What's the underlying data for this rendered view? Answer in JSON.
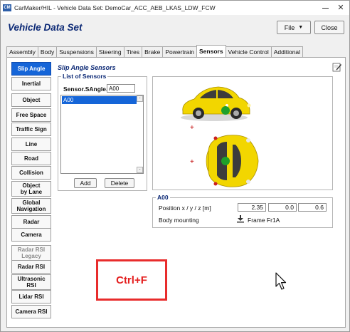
{
  "window": {
    "app_icon_text": "CM",
    "title": "CarMaker/HIL - Vehicle Data Set: DemoCar_ACC_AEB_LKAS_LDW_FCW"
  },
  "header": {
    "title": "Vehicle Data Set",
    "file_label": "File",
    "close_label": "Close"
  },
  "tabs": [
    {
      "label": "Assembly"
    },
    {
      "label": "Body"
    },
    {
      "label": "Suspensions"
    },
    {
      "label": "Steering"
    },
    {
      "label": "Tires"
    },
    {
      "label": "Brake"
    },
    {
      "label": "Powertrain"
    },
    {
      "label": "Sensors"
    },
    {
      "label": "Vehicle Control"
    },
    {
      "label": "Additional"
    }
  ],
  "sidebar": [
    {
      "label": "Slip Angle"
    },
    {
      "label": "Inertial"
    },
    {
      "label": "Object"
    },
    {
      "label": "Free Space"
    },
    {
      "label": "Traffic Sign"
    },
    {
      "label": "Line"
    },
    {
      "label": "Road"
    },
    {
      "label": "Collision"
    },
    {
      "label": "Object\nby Lane"
    },
    {
      "label": "Global\nNavigation"
    },
    {
      "label": "Radar"
    },
    {
      "label": "Camera"
    },
    {
      "label": "Radar RSI\nLegacy"
    },
    {
      "label": "Radar RSI"
    },
    {
      "label": "Ultrasonic\nRSI"
    },
    {
      "label": "Lidar RSI"
    },
    {
      "label": "Camera RSI"
    }
  ],
  "content": {
    "title": "Slip Angle Sensors",
    "list_group_title": "List of Sensors",
    "sensor_field_label": "Sensor.SAngle.",
    "sensor_field_value": "A00",
    "list_items": [
      "A00"
    ],
    "add_label": "Add",
    "delete_label": "Delete"
  },
  "sensor_details": {
    "group_title": "A00",
    "position_label": "Position x / y / z [m]",
    "position_x": "2.35",
    "position_y": "0.0",
    "position_z": "0.6",
    "mounting_label": "Body mounting",
    "mounting_value": "Frame Fr1A"
  },
  "overlay_text": "Ctrl+F",
  "colors": {
    "accent": "#1565d8",
    "title_blue": "#0b2875",
    "car_body": "#f2d600",
    "sensor_marker": "#1fa02a",
    "overlay_red": "#e82c2c"
  },
  "icons": [
    "app-icon",
    "caret-down-icon",
    "edit-icon",
    "download-icon",
    "mouse-cursor-icon",
    "minimize-icon",
    "close-icon"
  ]
}
